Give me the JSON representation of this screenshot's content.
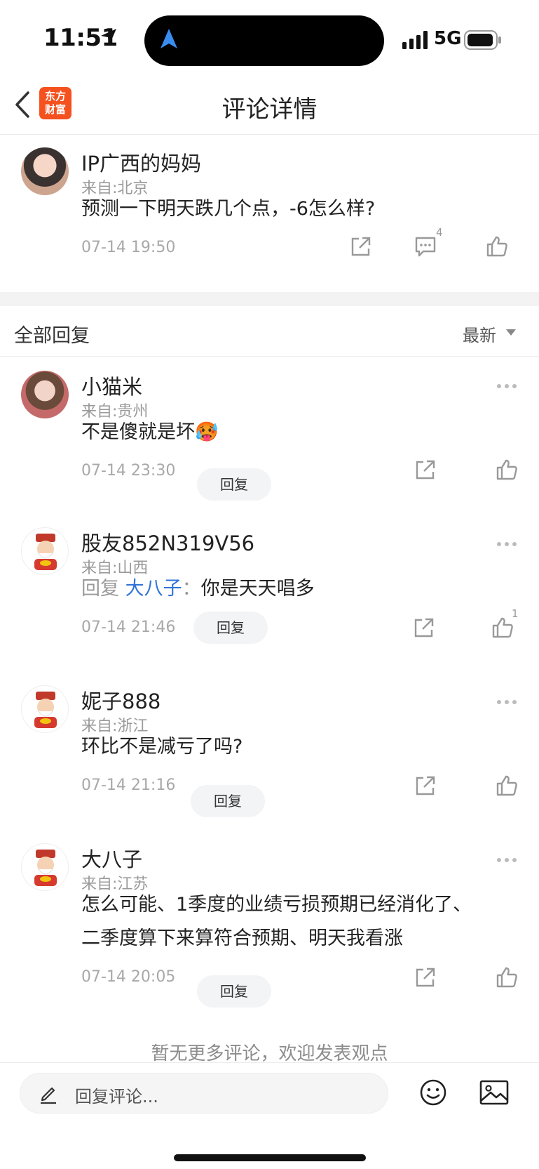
{
  "status_bar": {
    "time": "11:51",
    "network": "5G"
  },
  "header": {
    "logo_text": "东方\n财富",
    "title": "评论详情"
  },
  "main_comment": {
    "user": "IP广西的妈妈",
    "from": "来自:北京",
    "text": "预测一下明天跌几个点，-6怎么样?",
    "time": "07-14 19:50",
    "comment_count": "4"
  },
  "replies_header": {
    "title": "全部回复",
    "sort": "最新"
  },
  "replies": [
    {
      "user": "小猫米",
      "from": "来自:贵州",
      "text": "不是傻就是坏",
      "emoji": "🥵",
      "time": "07-14 23:30",
      "reply_label": "回复"
    },
    {
      "user": "股友852N319V56",
      "from": "来自:山西",
      "reply_prefix": "回复",
      "reply_target": "大八子",
      "separator": "：",
      "text": "你是天天唱多",
      "time": "07-14 21:46",
      "reply_label": "回复",
      "like_count": "1"
    },
    {
      "user": "妮子888",
      "from": "来自:浙江",
      "text": "环比不是减亏了吗?",
      "time": "07-14 21:16",
      "reply_label": "回复"
    },
    {
      "user": "大八子",
      "from": "来自:江苏",
      "text_line1": "怎么可能、1季度的业绩亏损预期已经消化了、",
      "text_line2": "二季度算下来算符合预期、明天我看涨",
      "time": "07-14 20:05",
      "reply_label": "回复"
    }
  ],
  "footer": {
    "no_more": "暂无更多评论，欢迎发表观点",
    "input_placeholder": "回复评论..."
  },
  "icons": {
    "back": "chevron-left-icon",
    "share": "share-icon",
    "comment": "comment-icon",
    "like": "thumbs-up-icon",
    "more": "more-dots-icon",
    "pen": "pen-icon",
    "emoji": "emoji-icon",
    "image": "image-icon"
  },
  "colors": {
    "brand": "#f4511e",
    "link": "#2f73d8",
    "muted": "#a8a8a8"
  }
}
